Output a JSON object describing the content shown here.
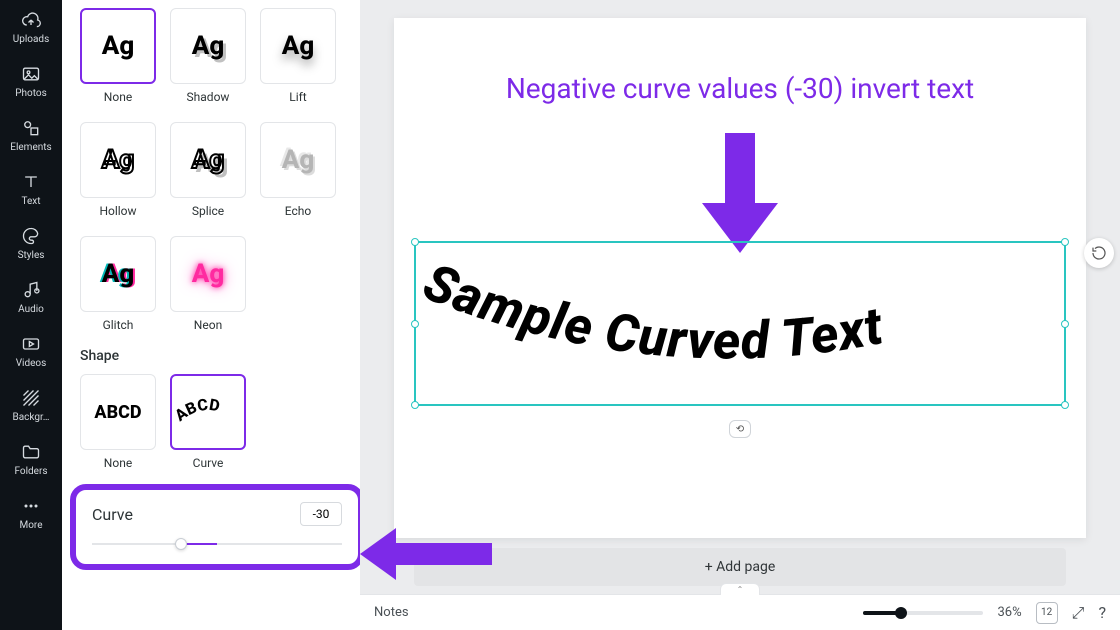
{
  "rail": [
    {
      "label": "Uploads",
      "icon": "cloud"
    },
    {
      "label": "Photos",
      "icon": "image"
    },
    {
      "label": "Elements",
      "icon": "shapes"
    },
    {
      "label": "Text",
      "icon": "text"
    },
    {
      "label": "Styles",
      "icon": "palette"
    },
    {
      "label": "Audio",
      "icon": "audio"
    },
    {
      "label": "Videos",
      "icon": "video"
    },
    {
      "label": "Backgr…",
      "icon": "hatch"
    },
    {
      "label": "Folders",
      "icon": "folder"
    },
    {
      "label": "More",
      "icon": "more"
    }
  ],
  "effects": {
    "style_items": [
      {
        "label": "None",
        "sample": "Ag",
        "variant": "none",
        "selected": true
      },
      {
        "label": "Shadow",
        "sample": "Ag",
        "variant": "shadow",
        "selected": false
      },
      {
        "label": "Lift",
        "sample": "Ag",
        "variant": "lift",
        "selected": false
      },
      {
        "label": "Hollow",
        "sample": "Ag",
        "variant": "hollow",
        "selected": false
      },
      {
        "label": "Splice",
        "sample": "Ag",
        "variant": "splice",
        "selected": false
      },
      {
        "label": "Echo",
        "sample": "Ag",
        "variant": "echo",
        "selected": false
      },
      {
        "label": "Glitch",
        "sample": "Ag",
        "variant": "glitch",
        "selected": false
      },
      {
        "label": "Neon",
        "sample": "Ag",
        "variant": "neon",
        "selected": false
      }
    ],
    "shape_title": "Shape",
    "shape_items": [
      {
        "label": "None",
        "sample": "ABCD",
        "variant": "abcd-none",
        "selected": false
      },
      {
        "label": "Curve",
        "sample": "ABCD",
        "variant": "abcd-curve",
        "selected": true
      }
    ],
    "curve": {
      "label": "Curve",
      "value": "-30",
      "min": -100,
      "max": 100
    }
  },
  "canvas": {
    "callout": "Negative curve values (-30) invert text",
    "curved_text": "Sample Curved Text",
    "add_page": "+ Add page"
  },
  "bottom": {
    "notes": "Notes",
    "zoom": "36%",
    "pages_icon": "12"
  },
  "colors": {
    "accent": "#7d2ae8",
    "selection": "#29c5c0"
  }
}
